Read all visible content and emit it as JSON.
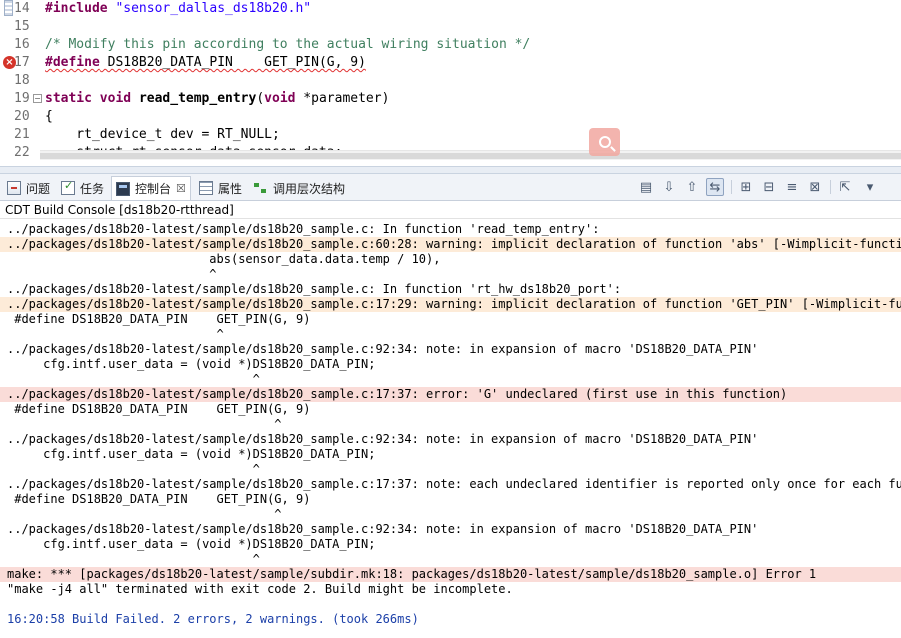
{
  "editor": {
    "lines": [
      {
        "num": "14",
        "parts": [
          {
            "t": "#include",
            "c": "kw"
          },
          {
            "t": " ",
            "c": ""
          },
          {
            "t": "\"sensor_dallas_ds18b20.h\"",
            "c": "str"
          }
        ],
        "marker": "bookmark"
      },
      {
        "num": "15",
        "parts": []
      },
      {
        "num": "16",
        "parts": [
          {
            "t": "/* Modify this pin according to the actual wiring situation */",
            "c": "cmt"
          }
        ]
      },
      {
        "num": "17",
        "parts": [
          {
            "t": "#define",
            "c": "kw squiggle"
          },
          {
            "t": " DS18B20_DATA_PIN    GET_PIN(G, 9)",
            "c": "squiggle"
          }
        ],
        "marker": "error"
      },
      {
        "num": "18",
        "parts": []
      },
      {
        "num": "19",
        "parts": [
          {
            "t": "static",
            "c": "kw"
          },
          {
            "t": " ",
            "c": ""
          },
          {
            "t": "void",
            "c": "kw"
          },
          {
            "t": " ",
            "c": ""
          },
          {
            "t": "read_temp_entry",
            "c": "fn"
          },
          {
            "t": "(",
            "c": ""
          },
          {
            "t": "void",
            "c": "kw"
          },
          {
            "t": " *parameter)",
            "c": ""
          }
        ],
        "marker": "fold"
      },
      {
        "num": "20",
        "parts": [
          {
            "t": "{",
            "c": ""
          }
        ]
      },
      {
        "num": "21",
        "parts": [
          {
            "t": "    rt_device_t dev = RT_NULL;",
            "c": ""
          }
        ]
      },
      {
        "num": "22",
        "parts": [
          {
            "t": "    struct rt_sensor_data sensor_data;",
            "c": ""
          }
        ]
      }
    ]
  },
  "tabs": [
    {
      "label": "问题",
      "icon": "problems-icon",
      "active": false
    },
    {
      "label": "任务",
      "icon": "tasks-icon",
      "active": false
    },
    {
      "label": "控制台",
      "icon": "console-icon",
      "active": true,
      "close": "☒"
    },
    {
      "label": "属性",
      "icon": "properties-icon",
      "active": false
    },
    {
      "label": "调用层次结构",
      "icon": "call-hierarchy-icon",
      "active": false
    }
  ],
  "toolbar": [
    {
      "name": "display-selected-console-icon",
      "glyph": "▤"
    },
    {
      "name": "scroll-down-icon",
      "glyph": "⇩"
    },
    {
      "name": "scroll-up-icon",
      "glyph": "⇧"
    },
    {
      "name": "scroll-lock-icon",
      "glyph": "⇆",
      "pressed": true
    },
    {
      "name": "pin-console-icon",
      "glyph": "⊞"
    },
    {
      "name": "new-console-icon",
      "glyph": "⊟"
    },
    {
      "name": "word-wrap-icon",
      "glyph": "≡"
    },
    {
      "name": "clear-console-icon",
      "glyph": "⊠"
    },
    {
      "name": "open-console-icon",
      "glyph": "⇱"
    },
    {
      "name": "view-menu-icon",
      "glyph": "▾"
    }
  ],
  "console_title": "CDT Build Console [ds18b20-rtthread]",
  "console_lines": [
    {
      "text": "../packages/ds18b20-latest/sample/ds18b20_sample.c: In function 'read_temp_entry':",
      "kind": "plain"
    },
    {
      "text": "../packages/ds18b20-latest/sample/ds18b20_sample.c:60:28: warning: implicit declaration of function 'abs' [-Wimplicit-function-declaration]",
      "kind": "warn"
    },
    {
      "text": "                            abs(sensor_data.data.temp / 10),",
      "kind": "plain"
    },
    {
      "text": "                            ^",
      "kind": "plain"
    },
    {
      "text": "../packages/ds18b20-latest/sample/ds18b20_sample.c: In function 'rt_hw_ds18b20_port':",
      "kind": "plain"
    },
    {
      "text": "../packages/ds18b20-latest/sample/ds18b20_sample.c:17:29: warning: implicit declaration of function 'GET_PIN' [-Wimplicit-function-declaration]",
      "kind": "warn"
    },
    {
      "text": " #define DS18B20_DATA_PIN    GET_PIN(G, 9)",
      "kind": "plain"
    },
    {
      "text": "                             ^",
      "kind": "plain"
    },
    {
      "text": "../packages/ds18b20-latest/sample/ds18b20_sample.c:92:34: note: in expansion of macro 'DS18B20_DATA_PIN'",
      "kind": "plain"
    },
    {
      "text": "     cfg.intf.user_data = (void *)DS18B20_DATA_PIN;",
      "kind": "plain"
    },
    {
      "text": "                                  ^",
      "kind": "plain"
    },
    {
      "text": "../packages/ds18b20-latest/sample/ds18b20_sample.c:17:37: error: 'G' undeclared (first use in this function)",
      "kind": "err"
    },
    {
      "text": " #define DS18B20_DATA_PIN    GET_PIN(G, 9)",
      "kind": "plain"
    },
    {
      "text": "                                     ^",
      "kind": "plain"
    },
    {
      "text": "../packages/ds18b20-latest/sample/ds18b20_sample.c:92:34: note: in expansion of macro 'DS18B20_DATA_PIN'",
      "kind": "plain"
    },
    {
      "text": "     cfg.intf.user_data = (void *)DS18B20_DATA_PIN;",
      "kind": "plain"
    },
    {
      "text": "                                  ^",
      "kind": "plain"
    },
    {
      "text": "../packages/ds18b20-latest/sample/ds18b20_sample.c:17:37: note: each undeclared identifier is reported only once for each function it appears in",
      "kind": "plain"
    },
    {
      "text": " #define DS18B20_DATA_PIN    GET_PIN(G, 9)",
      "kind": "plain"
    },
    {
      "text": "                                     ^",
      "kind": "plain"
    },
    {
      "text": "../packages/ds18b20-latest/sample/ds18b20_sample.c:92:34: note: in expansion of macro 'DS18B20_DATA_PIN'",
      "kind": "plain"
    },
    {
      "text": "     cfg.intf.user_data = (void *)DS18B20_DATA_PIN;",
      "kind": "plain"
    },
    {
      "text": "                                  ^",
      "kind": "plain"
    },
    {
      "text": "make: *** [packages/ds18b20-latest/sample/subdir.mk:18: packages/ds18b20-latest/sample/ds18b20_sample.o] Error 1",
      "kind": "err"
    },
    {
      "text": "\"make -j4 all\" terminated with exit code 2. Build might be incomplete.",
      "kind": "plain"
    },
    {
      "text": "",
      "kind": "plain"
    },
    {
      "text": "16:20:58 Build Failed. 2 errors, 2 warnings. (took 266ms)",
      "kind": "status"
    }
  ],
  "colors": {
    "warning_bg": "#fdebd8",
    "error_bg": "#fadcd8",
    "status_text": "#1b3fa8",
    "keyword": "#7f0055",
    "string": "#2a00ff",
    "comment": "#3f7f5f"
  }
}
